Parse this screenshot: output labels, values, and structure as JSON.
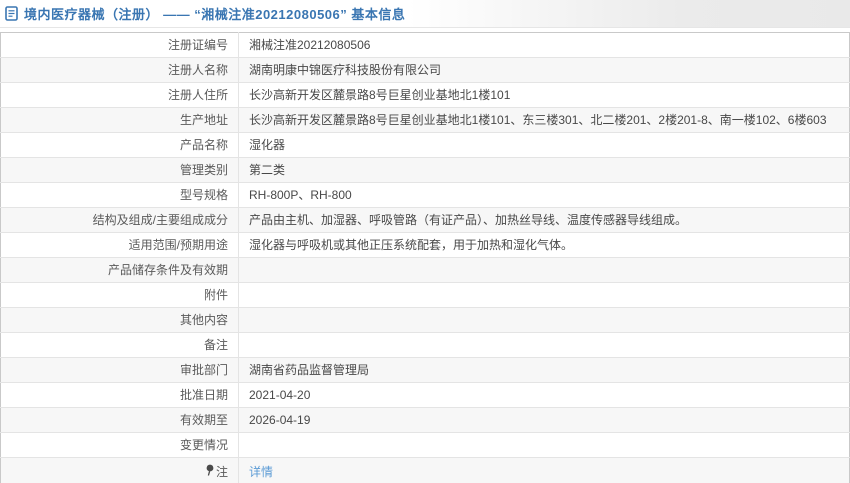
{
  "header": {
    "title": "境内医疗器械（注册） —— “湘械注准20212080506” 基本信息"
  },
  "table": {
    "rows": [
      {
        "label": "注册证编号",
        "value": "湘械注准20212080506"
      },
      {
        "label": "注册人名称",
        "value": "湖南明康中锦医疗科技股份有限公司"
      },
      {
        "label": "注册人住所",
        "value": "长沙高新开发区麓景路8号巨星创业基地北1楼101"
      },
      {
        "label": "生产地址",
        "value": "长沙高新开发区麓景路8号巨星创业基地北1楼101、东三楼301、北二楼201、2楼201-8、南一楼102、6楼603"
      },
      {
        "label": "产品名称",
        "value": "湿化器"
      },
      {
        "label": "管理类别",
        "value": "第二类"
      },
      {
        "label": "型号规格",
        "value": "RH-800P、RH-800"
      },
      {
        "label": "结构及组成/主要组成成分",
        "value": "产品由主机、加湿器、呼吸管路（有证产品）、加热丝导线、温度传感器导线组成。"
      },
      {
        "label": "适用范围/预期用途",
        "value": "湿化器与呼吸机或其他正压系统配套，用于加热和湿化气体。"
      },
      {
        "label": "产品储存条件及有效期",
        "value": ""
      },
      {
        "label": "附件",
        "value": ""
      },
      {
        "label": "其他内容",
        "value": ""
      },
      {
        "label": "备注",
        "value": ""
      },
      {
        "label": "审批部门",
        "value": "湖南省药品监督管理局"
      },
      {
        "label": "批准日期",
        "value": "2021-04-20"
      },
      {
        "label": "有效期至",
        "value": "2026-04-19"
      },
      {
        "label": "变更情况",
        "value": ""
      },
      {
        "label": "注",
        "value": "详情"
      }
    ]
  },
  "icons": {
    "header_icon": "document-icon",
    "note_icon": "pin-icon"
  },
  "colors": {
    "title_blue": "#3a76b2",
    "link_blue": "#5b9bd5",
    "stripe_gray": "#f7f7f7",
    "border_gray": "#e4e4e4"
  }
}
